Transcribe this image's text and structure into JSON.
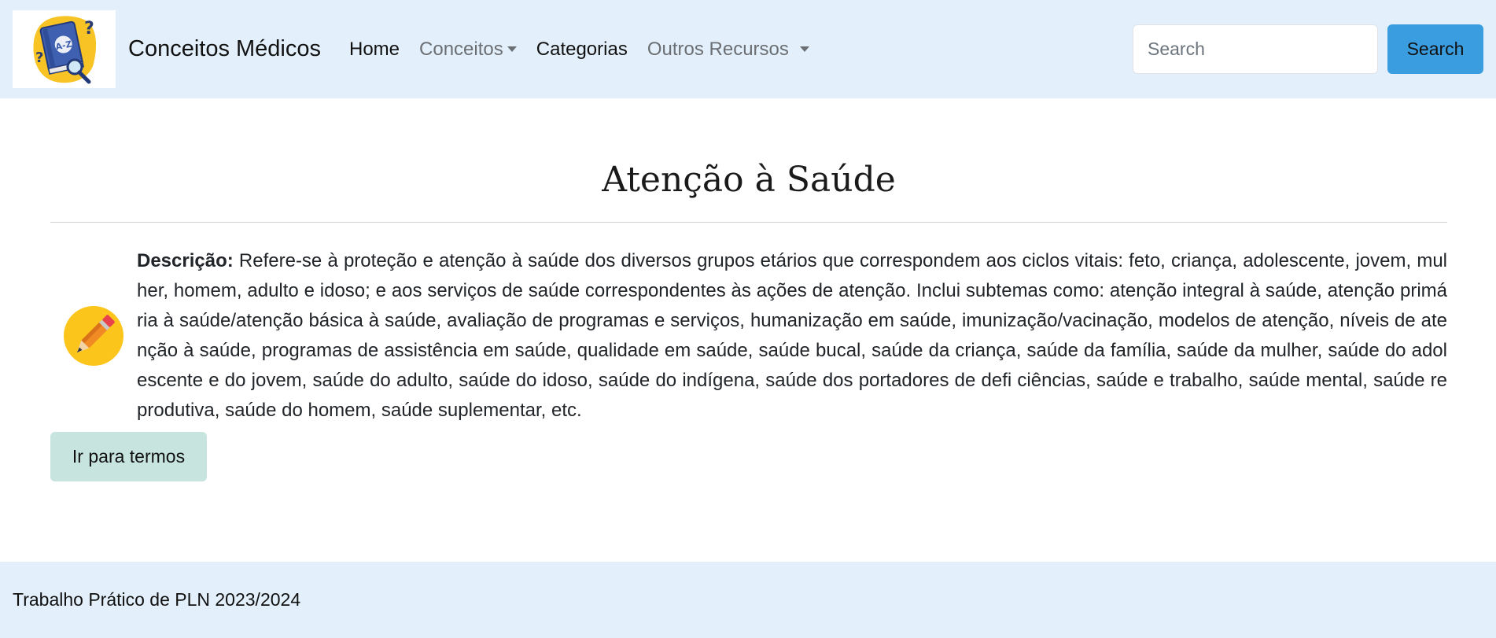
{
  "brand": {
    "logo_icon": "medical-dictionary-book-icon",
    "logo_text": "A-Z",
    "name": "Conceitos Médicos"
  },
  "nav": {
    "items": [
      {
        "label": "Home",
        "active": true,
        "dropdown": false
      },
      {
        "label": "Conceitos",
        "active": false,
        "dropdown": true
      },
      {
        "label": "Categorias",
        "active": true,
        "dropdown": false
      },
      {
        "label": "Outros Recursos",
        "active": false,
        "dropdown": true
      }
    ]
  },
  "search": {
    "placeholder": "Search",
    "value": "",
    "button_label": "Search"
  },
  "main": {
    "title": "Atenção à Saúde",
    "description_label": "Descrição:",
    "description_text": "Refere-se à proteção e atenção à saúde dos diversos grupos etários que correspondem aos ciclos vitais: feto, criança, adolescente, jovem, mulher, homem, adulto e idoso; e aos serviços de saúde correspondentes às ações de atenção. Inclui subtemas como: atenção integral à saúde, atenção primária à saúde/atenção básica à saúde, avaliação de programas e serviços, humanização em saúde, imunização/vacinação, modelos de atenção, níveis de atenção à saúde, programas de assistência em saúde, qualidade em saúde, saúde bucal, saúde da criança, saúde da família, saúde da mulher, saúde do adolescente e do jovem, saúde do adulto, saúde do idoso, saúde do indígena, saúde dos portadores de defi ciências, saúde e trabalho, saúde mental, saúde reprodutiva, saúde do homem, saúde suplementar, etc.",
    "description_icon": "pencil-icon",
    "terms_button_label": "Ir para termos"
  },
  "footer": {
    "text": "Trabalho Prático de PLN 2023/2024"
  },
  "colors": {
    "navbar_bg": "#e3f0fb",
    "search_button": "#3a9de0",
    "terms_button": "#c7e5de",
    "footer_bg": "#e3f0fb"
  }
}
